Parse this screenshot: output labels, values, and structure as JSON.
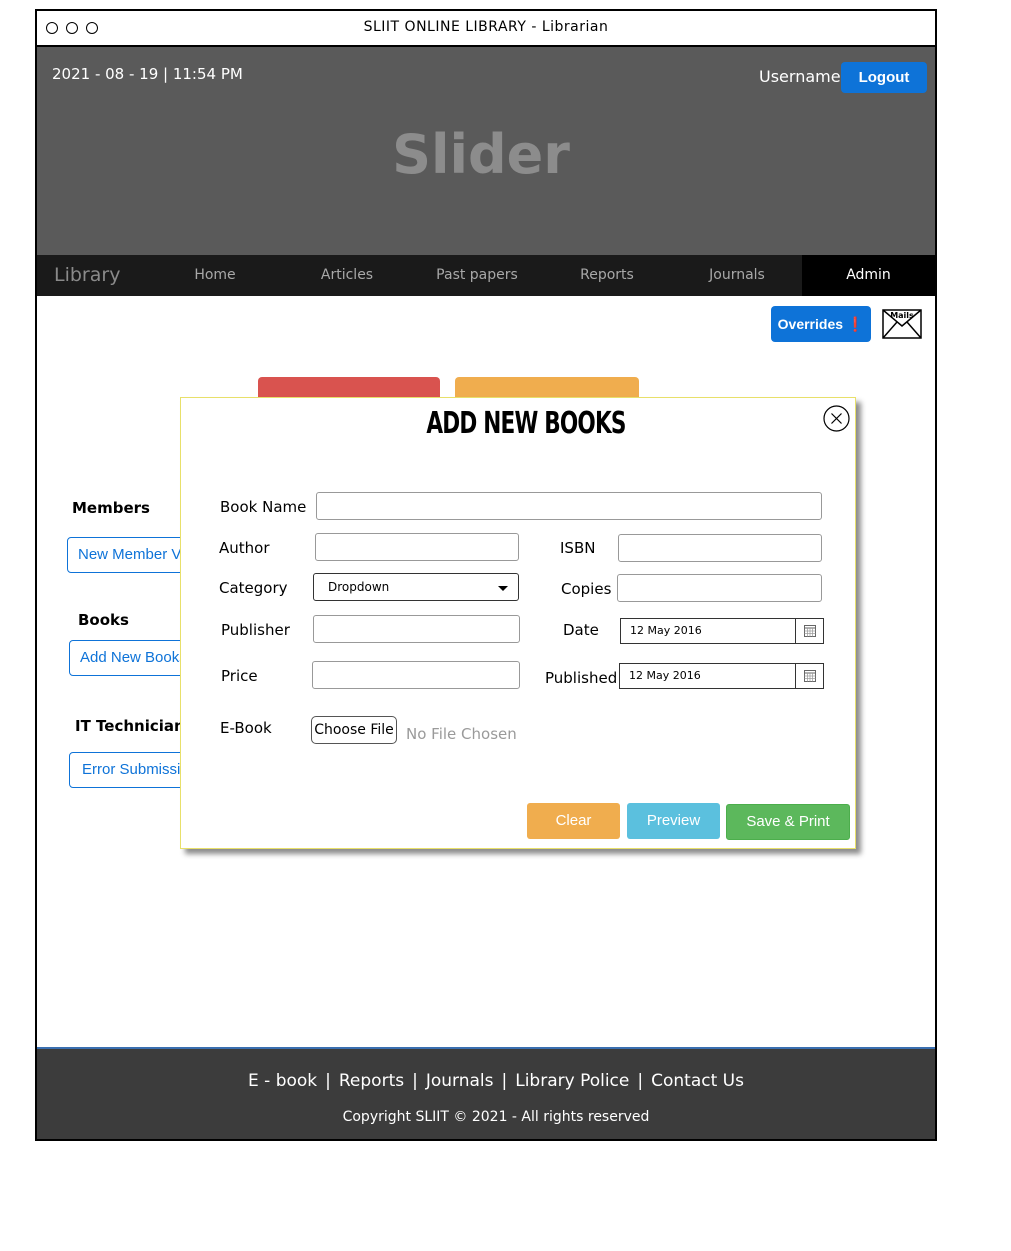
{
  "window": {
    "title": "SLIIT ONLINE LIBRARY - Librarian"
  },
  "header": {
    "datetime": "2021 - 08 - 19 | 11:54 PM",
    "username": "Username",
    "logout_label": "Logout",
    "slider_text": "Slider"
  },
  "nav": {
    "brand": "Library",
    "items": [
      {
        "label": "Home"
      },
      {
        "label": "Articles"
      },
      {
        "label": "Past papers"
      },
      {
        "label": "Reports"
      },
      {
        "label": "Journals"
      },
      {
        "label": "Admin",
        "active": true
      }
    ]
  },
  "toolbar": {
    "overrides_label": "Overrides ❗",
    "mails_label": "Mails"
  },
  "sidebar": {
    "members_heading": "Members",
    "members_button": "New Member Verification",
    "books_heading": "Books",
    "books_button": "Add New Books",
    "it_heading": "IT Technician",
    "it_button": "Error Submission"
  },
  "modal": {
    "title": "ADD NEW BOOKS",
    "fields": {
      "book_name_label": "Book Name",
      "author_label": "Author",
      "isbn_label": "ISBN",
      "category_label": "Category",
      "category_value": "Dropdown",
      "copies_label": "Copies",
      "publisher_label": "Publisher",
      "date_label": "Date",
      "date_value": "12 May 2016",
      "price_label": "Price",
      "published_label": "Published",
      "published_value": "12 May 2016",
      "ebook_label": "E-Book",
      "choose_file_label": "Choose File",
      "no_file_text": "No File Chosen"
    },
    "buttons": {
      "clear": "Clear",
      "preview": "Preview",
      "save_print": "Save & Print"
    }
  },
  "footer": {
    "links": [
      "E - book",
      "Reports",
      "Journals",
      "Library Police",
      "Contact Us"
    ],
    "copyright": "Copyright SLIIT © 2021 - All rights reserved"
  },
  "colors": {
    "primary": "#0e73d8",
    "header_bg": "#5a5a5a",
    "nav_bg": "#1a1a1a",
    "footer_bg": "#3c3c3c",
    "clear": "#f0ad4e",
    "preview": "#5bc0de",
    "save": "#5cb85c",
    "tab_red": "#d9534f",
    "tab_orange": "#f0ad4e"
  }
}
